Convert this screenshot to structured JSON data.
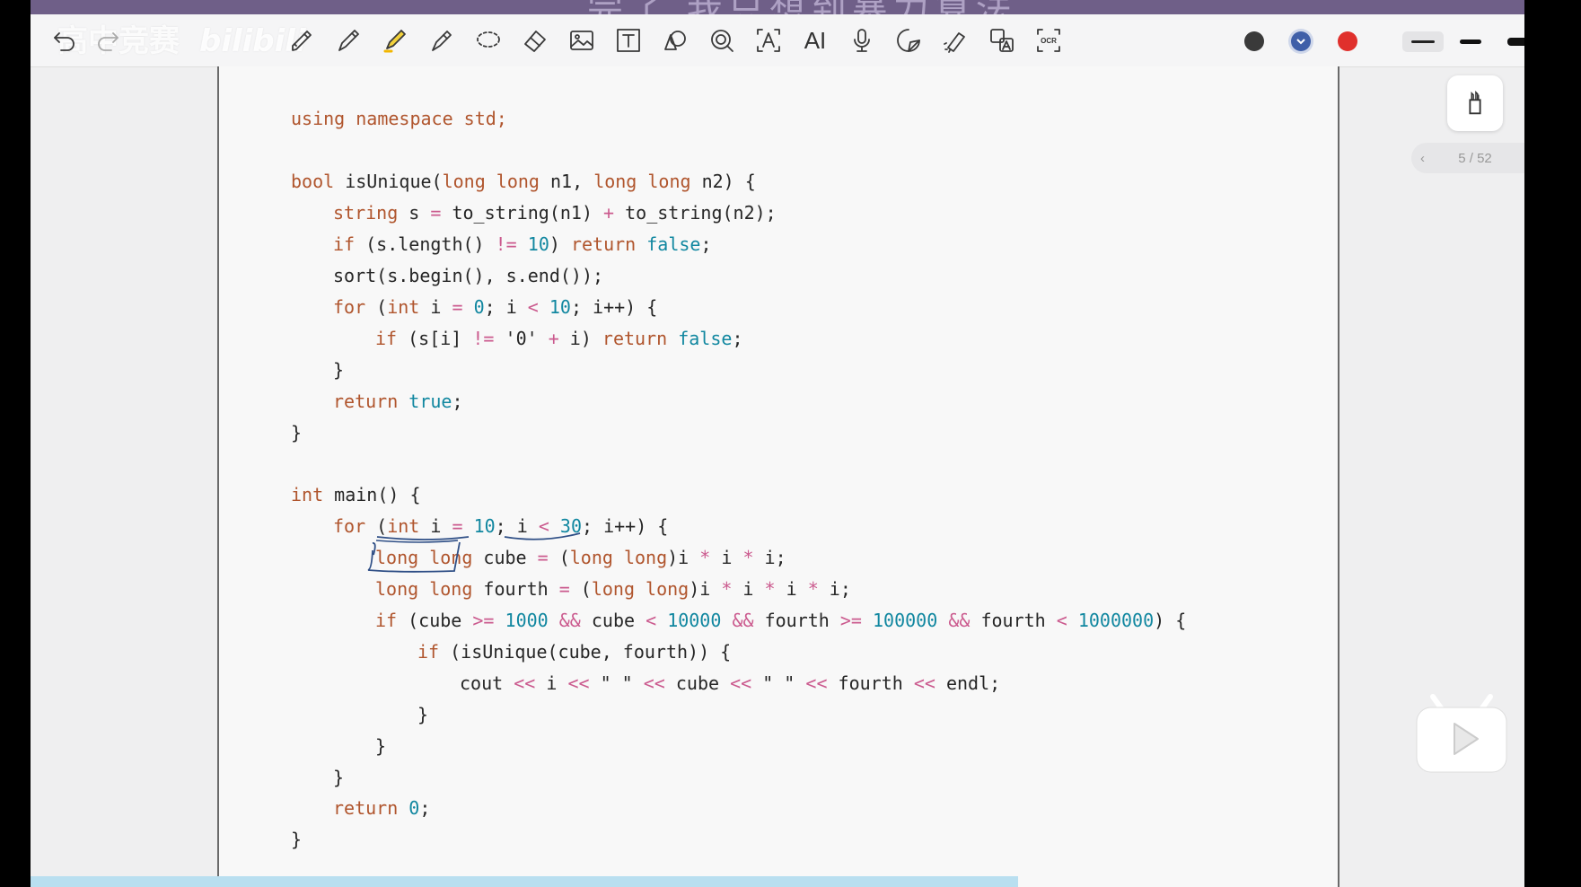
{
  "video": {
    "title": "完了 我只想到暴力算法",
    "watermark": "高中竞赛",
    "watermark_logo": "bilibili"
  },
  "toolbar": {
    "undo": "undo-icon",
    "redo": "redo-icon",
    "tools": [
      "lasso-pen-icon",
      "pen-icon",
      "highlighter-icon",
      "eraser-icon",
      "lasso-icon",
      "ruler-eraser-icon",
      "image-icon",
      "text-box-icon",
      "shapes-icon",
      "magnifier-icon",
      "text-recognition-icon",
      "ai-icon",
      "microphone-icon",
      "sticker-icon",
      "laser-pointer-icon",
      "translate-icon",
      "ocr-icon"
    ],
    "ai_label": "AI",
    "ocr_label": "OCR",
    "text_label": "T",
    "colors": [
      "#3a3a3a",
      "#3f5fa8",
      "#e0302c"
    ]
  },
  "pager": {
    "label": "5 / 52"
  },
  "code": {
    "using": "using namespace std;",
    "l1": [
      "bool",
      " isUnique(",
      "long long",
      " n1, ",
      "long long",
      " n2) {"
    ],
    "l2": [
      "string",
      " s ",
      "=",
      " to_string(n1) ",
      "+",
      " to_string(n2);"
    ],
    "l3": [
      "if",
      " (s.length() ",
      "!=",
      " ",
      "10",
      ") ",
      "return",
      " ",
      "false",
      ";"
    ],
    "l4": "sort(s.begin(), s.end());",
    "l5": [
      "for",
      " (",
      "int",
      " i ",
      "=",
      " ",
      "0",
      "; i ",
      "<",
      " ",
      "10",
      "; i++) {"
    ],
    "l6": [
      "if",
      " (s[i] ",
      "!=",
      " '0' ",
      "+",
      " i) ",
      "return",
      " ",
      "false",
      ";"
    ],
    "close1": "}",
    "l7": [
      "return",
      " ",
      "true",
      ";"
    ],
    "close2": "}",
    "m1": [
      "int",
      " main() {"
    ],
    "m2": [
      "for",
      " (",
      "int",
      " i ",
      "=",
      " ",
      "10",
      "; i ",
      "<",
      " ",
      "30",
      "; i++) {"
    ],
    "m3": [
      "long long",
      " cube ",
      "=",
      " (",
      "long long",
      ")i ",
      "*",
      " i ",
      "*",
      " i;"
    ],
    "m4": [
      "long long",
      " fourth ",
      "=",
      " (",
      "long long",
      ")i ",
      "*",
      " i ",
      "*",
      " i ",
      "*",
      " i;"
    ],
    "m5": [
      "if",
      " (cube ",
      ">=",
      " ",
      "1000",
      " ",
      "&&",
      " cube ",
      "<",
      " ",
      "10000",
      " ",
      "&&",
      " fourth ",
      ">=",
      " ",
      "100000",
      " ",
      "&&",
      " fourth ",
      "<",
      " ",
      "1000000",
      ") {"
    ],
    "m6": [
      "if",
      " (isUnique(cube, fourth)) {"
    ],
    "m7": [
      "cout",
      " ",
      "<<",
      " i ",
      "<<",
      " \" \" ",
      "<<",
      " cube ",
      "<<",
      " \" \" ",
      "<<",
      " fourth ",
      "<<",
      " endl;"
    ],
    "close3": "}",
    "close4": "}",
    "close5": "}",
    "m8": [
      "return",
      " ",
      "0",
      ";"
    ],
    "close6": "}"
  }
}
